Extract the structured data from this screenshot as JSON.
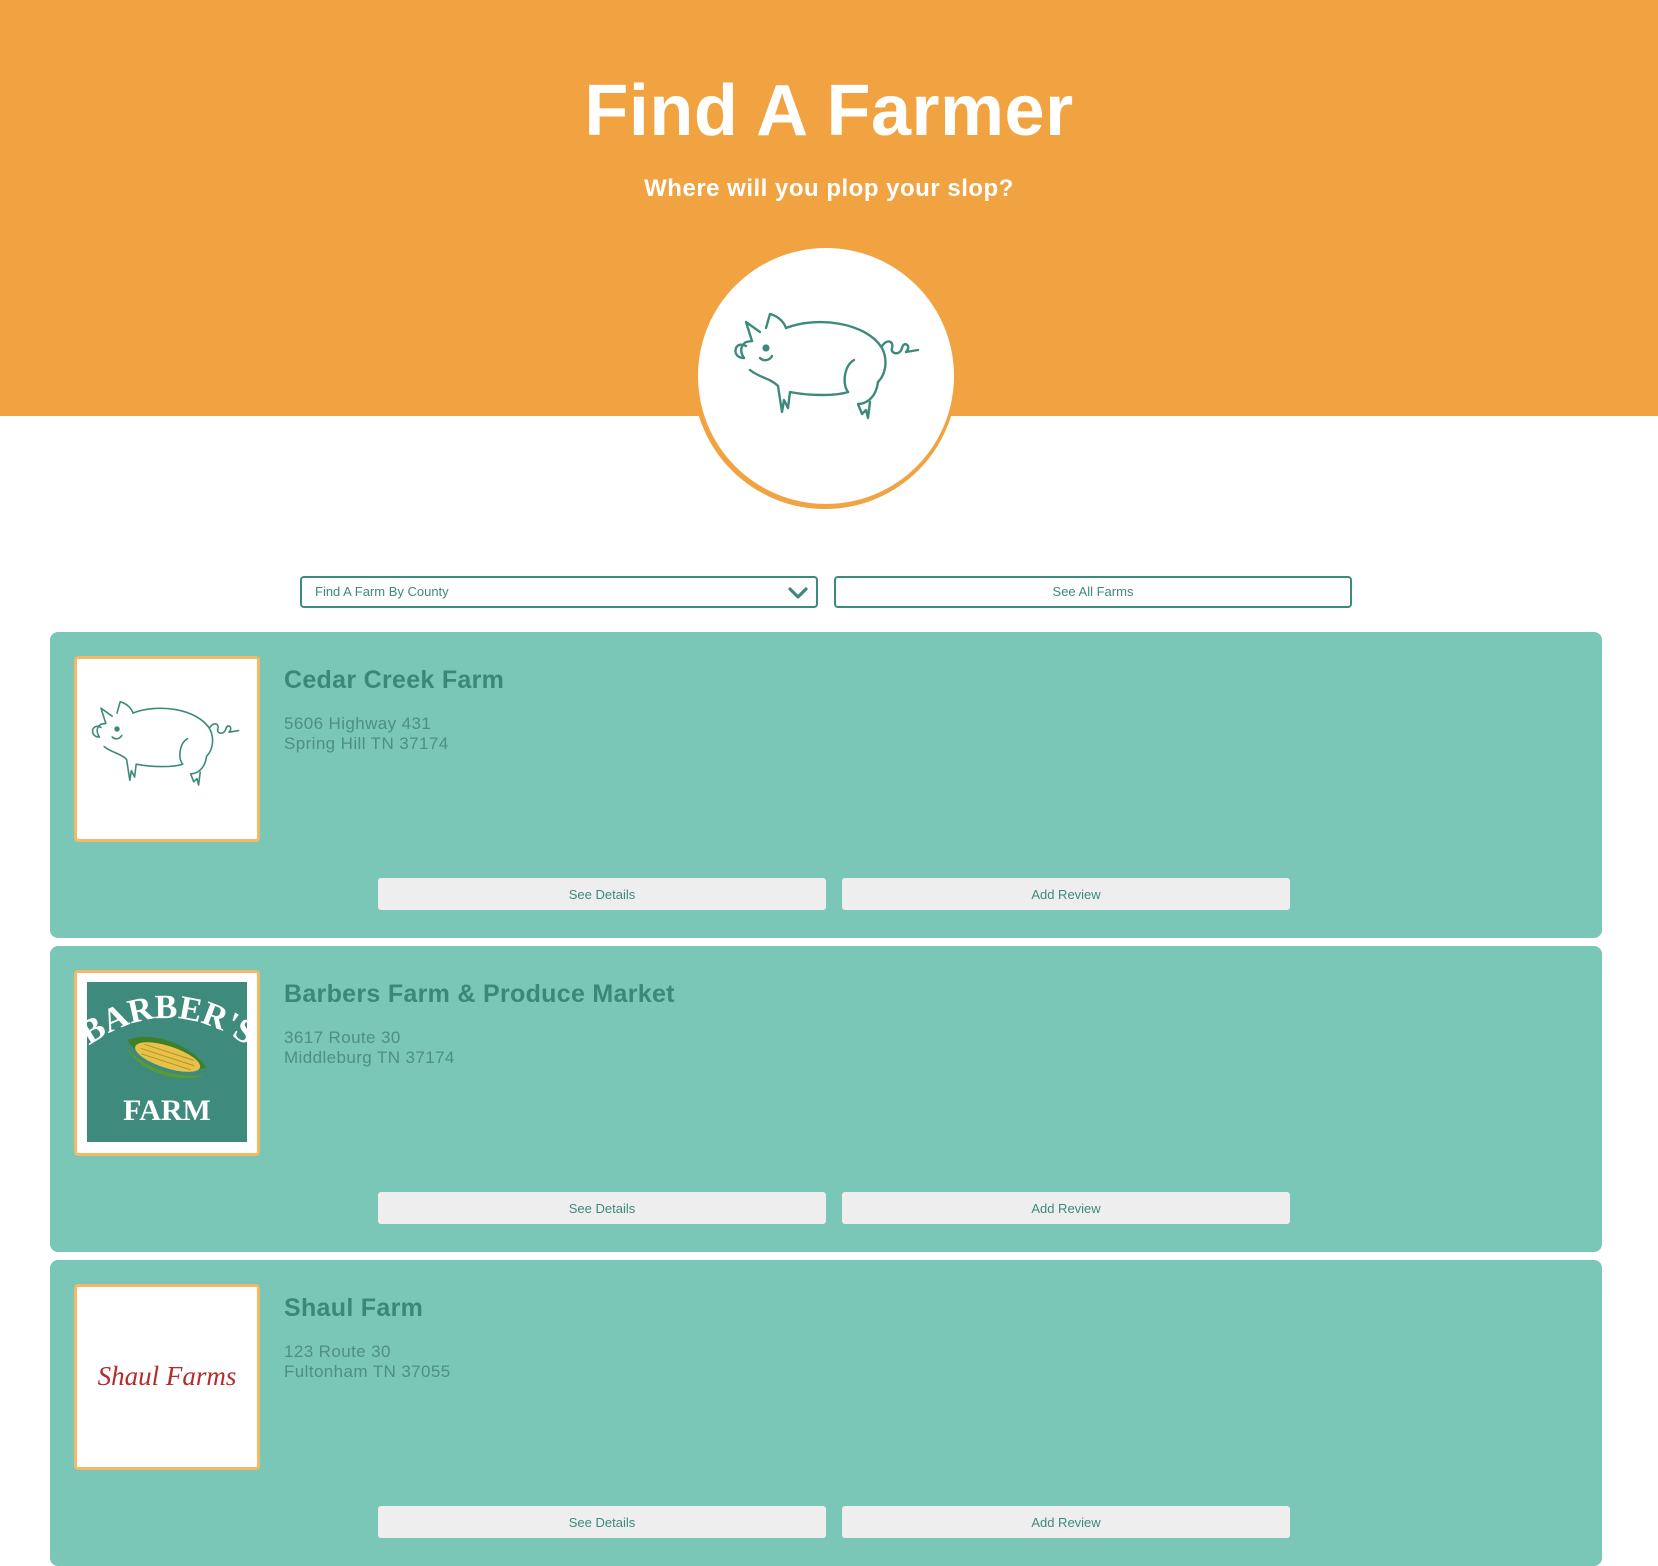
{
  "header": {
    "title": "Find A Farmer",
    "tagline": "Where will you plop your slop?",
    "medallion_icon": "pig-outline-icon"
  },
  "filters": {
    "county_select_value": "Find A Farm By County",
    "see_all_label": "See All Farms"
  },
  "farms": [
    {
      "name": "Cedar Creek Farm",
      "address_line1": "5606 Highway 431",
      "address_line2": "Spring Hill TN 37174",
      "image": "pig-outline-icon",
      "details_label": "See Details",
      "review_label": "Add Review"
    },
    {
      "name": "Barbers Farm & Produce Market",
      "address_line1": "3617 Route 30",
      "address_line2": "Middleburg TN 37174",
      "image": "barbers-farm-logo",
      "logo_text_top": "BARBER'S",
      "logo_text_bottom": "FARM",
      "details_label": "See Details",
      "review_label": "Add Review"
    },
    {
      "name": "Shaul Farm",
      "address_line1": "123 Route 30",
      "address_line2": "Fultonham TN 37055",
      "image": "shaul-farms-logo",
      "logo_text": "Shaul Farms",
      "details_label": "See Details",
      "review_label": "Add Review"
    }
  ],
  "colors": {
    "header_orange": "#f2a341",
    "card_teal": "#7ac7b7",
    "accent_teal": "#3d8a7c",
    "thumb_border": "#f5b867"
  }
}
